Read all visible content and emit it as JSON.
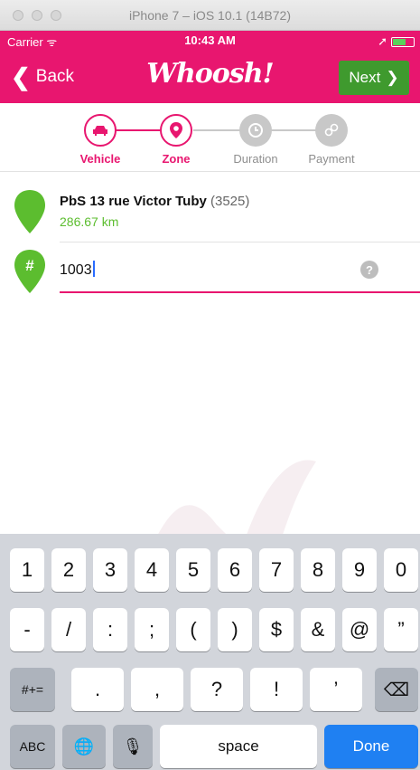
{
  "window": {
    "title": "iPhone 7 – iOS 10.1 (14B72)"
  },
  "status_bar": {
    "carrier": "Carrier",
    "wifi_glyph": "ᯤ",
    "time": "10:43 AM",
    "location_glyph": "➚"
  },
  "nav": {
    "back_chevron": "❮",
    "back_label": "Back",
    "logo": "Whoosh!",
    "next_label": "Next",
    "next_chevron": "❯"
  },
  "steps": [
    {
      "label": "Vehicle",
      "state": "active"
    },
    {
      "label": "Zone",
      "state": "active"
    },
    {
      "label": "Duration",
      "state": "inactive"
    },
    {
      "label": "Payment",
      "state": "inactive"
    }
  ],
  "zone": {
    "name": "PbS 13 rue Victor Tuby",
    "code": "(3525)",
    "distance": "286.67 km"
  },
  "space_input": {
    "pin_label": "#",
    "value": "1003",
    "help": "?"
  },
  "keyboard": {
    "row1": [
      "1",
      "2",
      "3",
      "4",
      "5",
      "6",
      "7",
      "8",
      "9",
      "0"
    ],
    "row2": [
      "-",
      "/",
      ":",
      ";",
      "(",
      ")",
      "$",
      "&",
      "@",
      "”"
    ],
    "row3": [
      ".",
      ",",
      "?",
      "!",
      "’"
    ],
    "symbols_key": "#+=",
    "delete_glyph": "⌫",
    "abc_key": "ABC",
    "globe_glyph": "🌐",
    "mic_glyph": "🎙",
    "space_key": "space",
    "done_key": "Done"
  },
  "colors": {
    "brand_pink": "#e8166f",
    "next_green": "#3f9a2e",
    "pin_green": "#5cbd2f",
    "done_blue": "#1f80f2"
  }
}
